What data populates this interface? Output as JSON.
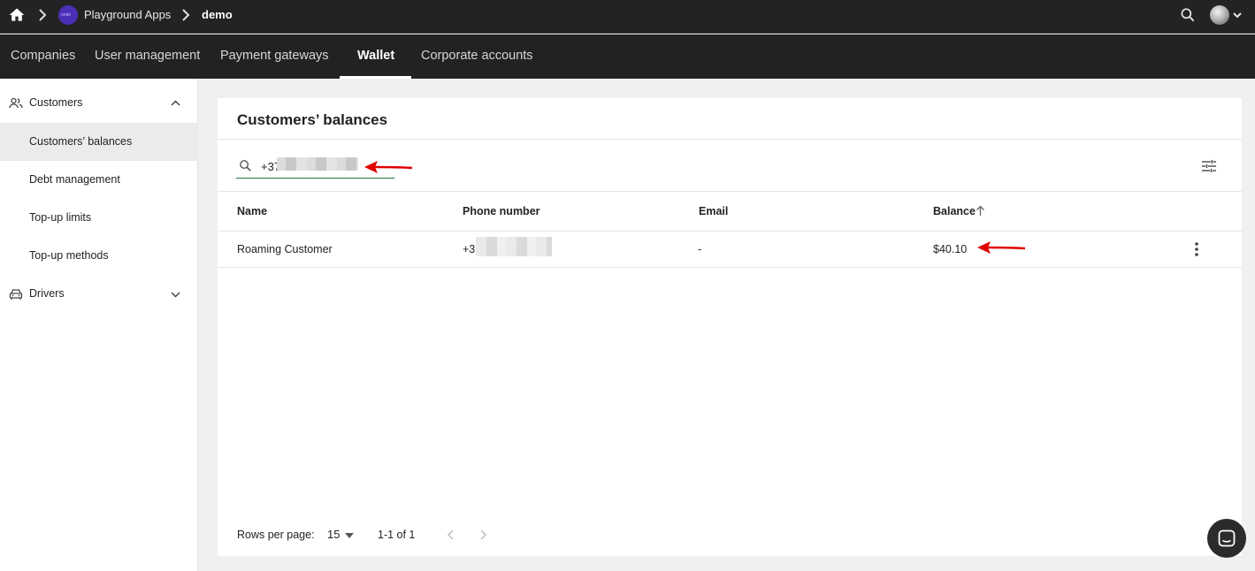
{
  "topbar": {
    "org_name": "Playground Apps",
    "logo_text": "onde",
    "env_name": "demo"
  },
  "nav": {
    "tabs": [
      {
        "label": "Companies"
      },
      {
        "label": "User management"
      },
      {
        "label": "Payment gateways"
      },
      {
        "label": "Wallet",
        "active": true
      },
      {
        "label": "Corporate accounts"
      }
    ]
  },
  "sidebar": {
    "customers_group": "Customers",
    "items": [
      {
        "label": "Customers’ balances",
        "active": true
      },
      {
        "label": "Debt management"
      },
      {
        "label": "Top-up limits"
      },
      {
        "label": "Top-up methods"
      }
    ],
    "drivers_group": "Drivers"
  },
  "main": {
    "title": "Customers’ balances",
    "search": {
      "value": "+37"
    },
    "table": {
      "headers": {
        "name": "Name",
        "phone": "Phone number",
        "email": "Email",
        "balance": "Balance"
      },
      "rows": [
        {
          "name": "Roaming Customer",
          "phone": "+37",
          "email": "-",
          "balance": "$40.10"
        }
      ]
    },
    "pagination": {
      "rows_label": "Rows per page:",
      "rows_value": "15",
      "range": "1-1 of 1"
    }
  },
  "colors": {
    "topbar_bg": "#232325",
    "search_underline": "#1e7a3a",
    "annotation_arrow": "#e00000"
  }
}
